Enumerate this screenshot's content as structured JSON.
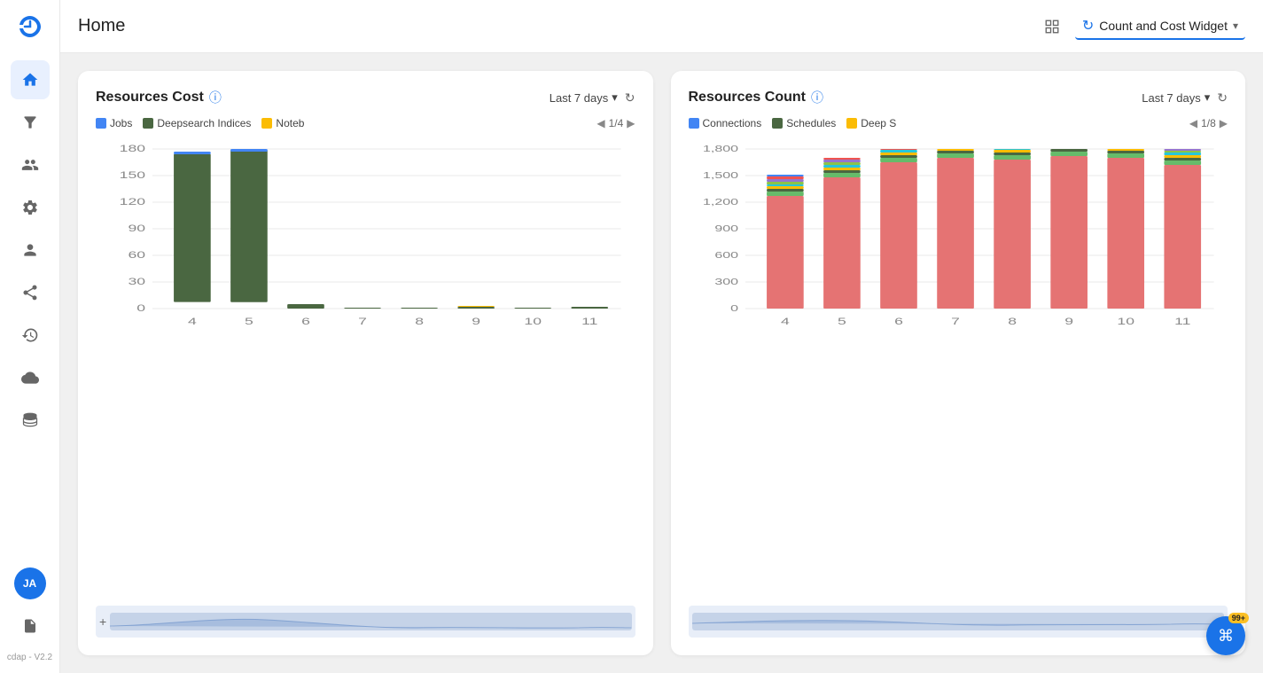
{
  "app": {
    "version": "cdap - V2.2",
    "title": "Home"
  },
  "header": {
    "title": "Home",
    "widget_label": "Count and Cost Widget",
    "layout_icon": "⊞",
    "refresh_icon": "↻",
    "chevron_icon": "⌄"
  },
  "sidebar": {
    "avatar_initials": "JA",
    "version": "cdap - V2.2",
    "items": [
      {
        "id": "home",
        "label": "Home",
        "active": true
      },
      {
        "id": "filter",
        "label": "Filter"
      },
      {
        "id": "group",
        "label": "Group"
      },
      {
        "id": "settings",
        "label": "Settings"
      },
      {
        "id": "user",
        "label": "User"
      },
      {
        "id": "connections",
        "label": "Connections"
      },
      {
        "id": "clock",
        "label": "History"
      },
      {
        "id": "cloud",
        "label": "Cloud"
      },
      {
        "id": "storage",
        "label": "Storage"
      }
    ]
  },
  "resources_cost": {
    "title": "Resources Cost",
    "time_range": "Last 7 days",
    "legend_page": "1/4",
    "legend_items": [
      {
        "label": "Jobs",
        "color": "#4285f4"
      },
      {
        "label": "Deepsearch Indices",
        "color": "#4a6741"
      },
      {
        "label": "Noteb",
        "color": "#fbbc04"
      }
    ],
    "y_axis_labels": [
      "180",
      "150",
      "120",
      "90",
      "60",
      "30",
      "0"
    ],
    "x_axis_labels": [
      "4",
      "5",
      "6",
      "7",
      "8",
      "9",
      "10",
      "11"
    ],
    "bars": [
      {
        "x": 4,
        "jobs": 2,
        "deepsearch": 168,
        "notebooks": 0
      },
      {
        "x": 5,
        "jobs": 3,
        "deepsearch": 178,
        "notebooks": 0
      },
      {
        "x": 6,
        "jobs": 0,
        "deepsearch": 5,
        "notebooks": 0
      },
      {
        "x": 7,
        "jobs": 0,
        "deepsearch": 1,
        "notebooks": 0
      },
      {
        "x": 8,
        "jobs": 0,
        "deepsearch": 1,
        "notebooks": 0
      },
      {
        "x": 9,
        "jobs": 0,
        "deepsearch": 2,
        "notebooks": 1
      },
      {
        "x": 10,
        "jobs": 0,
        "deepsearch": 1,
        "notebooks": 0
      },
      {
        "x": 11,
        "jobs": 0,
        "deepsearch": 2,
        "notebooks": 0
      }
    ]
  },
  "resources_count": {
    "title": "Resources Count",
    "time_range": "Last 7 days",
    "legend_page": "1/8",
    "legend_items": [
      {
        "label": "Connections",
        "color": "#4285f4"
      },
      {
        "label": "Schedules",
        "color": "#4a6741"
      },
      {
        "label": "Deep S",
        "color": "#fbbc04"
      }
    ],
    "y_axis_labels": [
      "1,800",
      "1,500",
      "1,200",
      "900",
      "600",
      "300",
      "0"
    ],
    "x_axis_labels": [
      "4",
      "5",
      "6",
      "7",
      "8",
      "9",
      "10",
      "11"
    ],
    "bars": [
      {
        "x": 4,
        "total": 1270,
        "top_color": "#e57373"
      },
      {
        "x": 5,
        "total": 1480,
        "top_color": "#e57373"
      },
      {
        "x": 6,
        "total": 1650,
        "top_color": "#e57373"
      },
      {
        "x": 7,
        "total": 1700,
        "top_color": "#e57373"
      },
      {
        "x": 8,
        "total": 1680,
        "top_color": "#e57373"
      },
      {
        "x": 9,
        "total": 1720,
        "top_color": "#e57373"
      },
      {
        "x": 10,
        "total": 1700,
        "top_color": "#e57373"
      },
      {
        "x": 11,
        "total": 1620,
        "top_color": "#e57373"
      }
    ]
  },
  "notification": {
    "count": "99+",
    "icon": "⌘"
  }
}
